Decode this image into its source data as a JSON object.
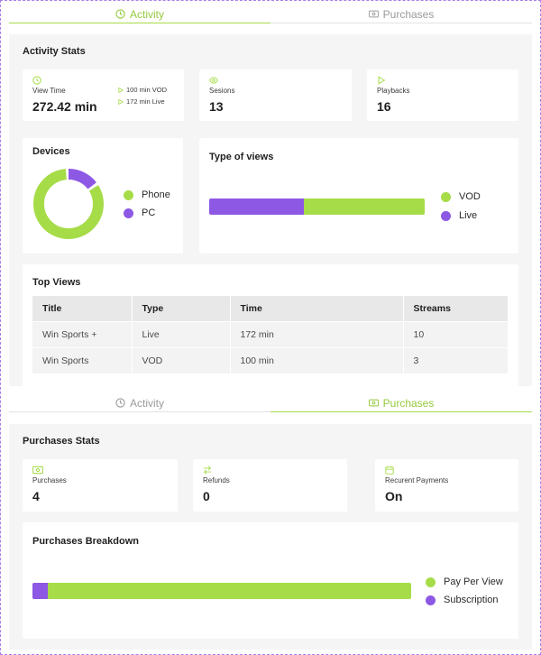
{
  "colors": {
    "accent_green": "#a6dc48",
    "accent_purple": "#8d58e4",
    "panel_bg": "#f5f5f5"
  },
  "activity_view": {
    "tabs": [
      {
        "label": "Activity",
        "icon": "clock-icon",
        "active": true
      },
      {
        "label": "Purchases",
        "icon": "money-icon",
        "active": false
      }
    ],
    "section_title": "Activity Stats",
    "stats": {
      "view_time": {
        "icon": "clock-icon",
        "label": "View Time",
        "value": "272.42 min",
        "notes": [
          "100 min VOD",
          "172 min Live"
        ]
      },
      "sessions": {
        "icon": "eye-icon",
        "label": "Sesions",
        "value": "13"
      },
      "playbacks": {
        "icon": "play-icon",
        "label": "Playbacks",
        "value": "16"
      }
    },
    "devices": {
      "title": "Devices",
      "legend": [
        {
          "label": "Phone",
          "color": "#a6dc48"
        },
        {
          "label": "PC",
          "color": "#8d58e4"
        }
      ],
      "share": {
        "phone": 0.84,
        "pc": 0.16
      }
    },
    "type_of_views": {
      "title": "Type of views",
      "legend": [
        {
          "label": "VOD",
          "color": "#a6dc48"
        },
        {
          "label": "Live",
          "color": "#8d58e4"
        }
      ],
      "share": {
        "live": 0.44,
        "vod": 0.56
      }
    },
    "top_views": {
      "title": "Top Views",
      "columns": [
        "Title",
        "Type",
        "Time",
        "Streams"
      ],
      "rows": [
        [
          "Win Sports +",
          "Live",
          "172 min",
          "10"
        ],
        [
          "Win Sports",
          "VOD",
          "100 min",
          "3"
        ]
      ]
    }
  },
  "purchases_view": {
    "tabs": [
      {
        "label": "Activity",
        "icon": "clock-icon",
        "active": false
      },
      {
        "label": "Purchases",
        "icon": "money-icon",
        "active": true
      }
    ],
    "section_title": "Purchases Stats",
    "stats": {
      "purchases": {
        "icon": "money-icon",
        "label": "Purchases",
        "value": "4"
      },
      "refunds": {
        "icon": "transfer-icon",
        "label": "Refunds",
        "value": "0"
      },
      "recurrent": {
        "icon": "calendar-icon",
        "label": "Recurent Payments",
        "value": "On"
      }
    },
    "breakdown": {
      "title": "Purchases Breakdown",
      "legend": [
        {
          "label": "Pay Per View",
          "color": "#a6dc48"
        },
        {
          "label": "Subscription",
          "color": "#8d58e4"
        }
      ],
      "share": {
        "subscription": 0.04,
        "pay_per_view": 0.96
      }
    }
  }
}
